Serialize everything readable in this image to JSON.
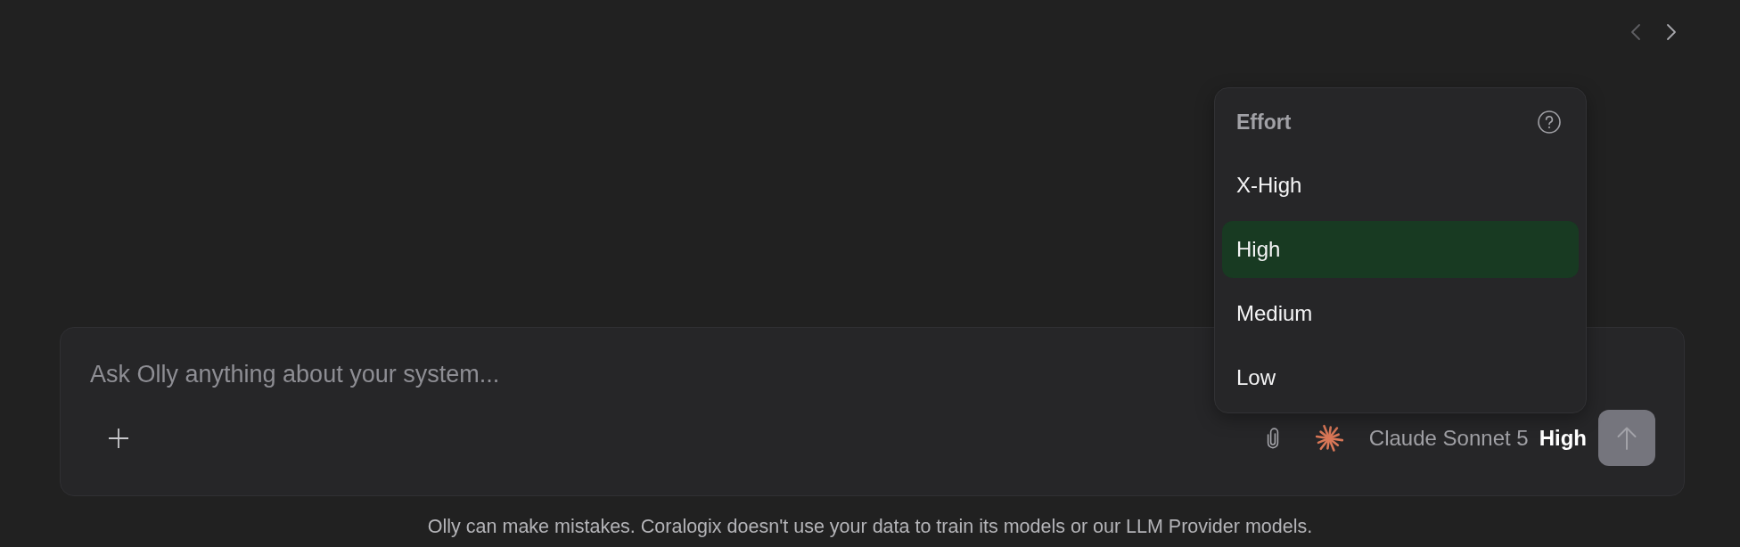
{
  "nav": [
    {
      "kind": "prev",
      "disabled": true
    },
    {
      "kind": "next",
      "disabled": false
    }
  ],
  "effort_menu": {
    "title": "Effort",
    "options": [
      {
        "label": "X-High",
        "selected": false
      },
      {
        "label": "High",
        "selected": true
      },
      {
        "label": "Medium",
        "selected": false
      },
      {
        "label": "Low",
        "selected": false
      }
    ]
  },
  "composer": {
    "placeholder": "Ask Olly anything about your system...",
    "model": "Claude Sonnet 5",
    "effort": "High",
    "send_button": {
      "disabled": true
    }
  },
  "disclaimer": "Olly can make mistakes. Coralogix doesn't use your data to train its models or our LLM Provider models."
}
